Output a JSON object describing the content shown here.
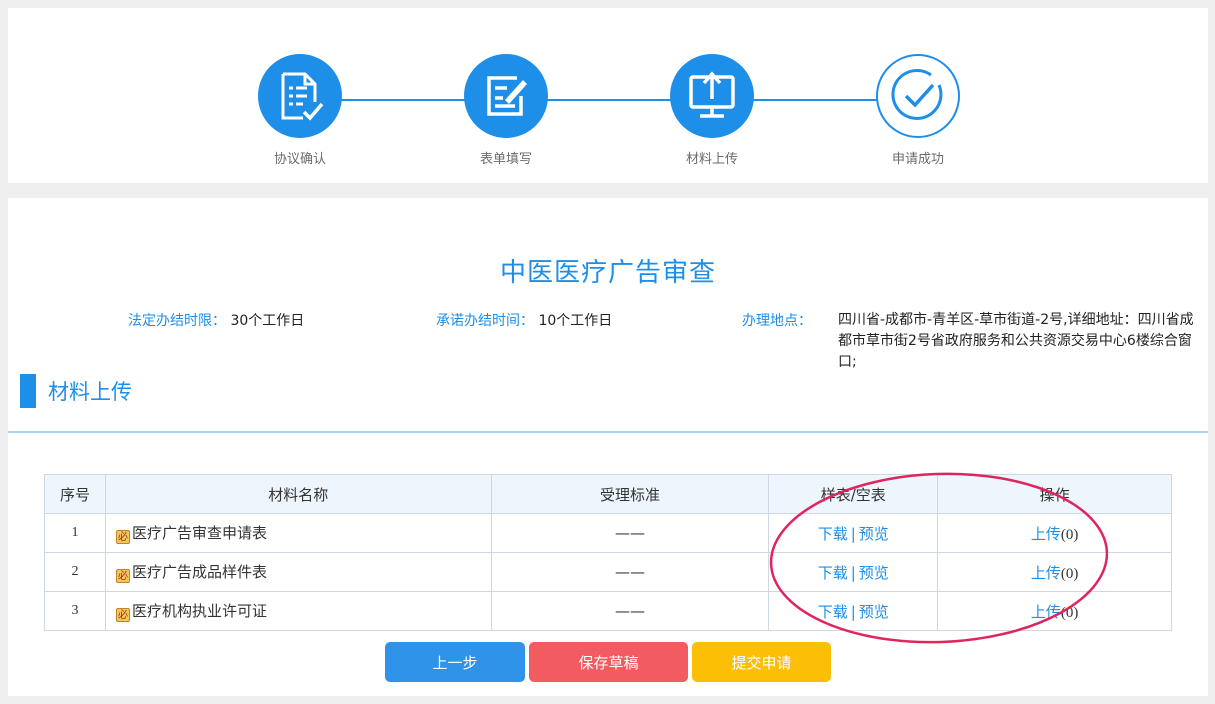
{
  "steps": [
    {
      "label": "协议确认",
      "icon": "document-check-icon"
    },
    {
      "label": "表单填写",
      "icon": "edit-form-icon"
    },
    {
      "label": "材料上传",
      "icon": "monitor-upload-icon"
    },
    {
      "label": "申请成功",
      "icon": "circle-check-icon"
    }
  ],
  "title": "中医医疗广告审查",
  "info": {
    "legal_label": "法定办结时限：",
    "legal_value": "30个工作日",
    "promise_label": "承诺办结时间：",
    "promise_value": "10个工作日",
    "address_label": "办理地点：",
    "address_value": "四川省-成都市-青羊区-草市街道-2号,详细地址：四川省成都市草市街2号省政府服务和公共资源交易中心6楼综合窗口;"
  },
  "section_title": "材料上传",
  "table": {
    "headers": [
      "序号",
      "材料名称",
      "受理标准",
      "样表/空表",
      "操作"
    ],
    "required_mark": "必",
    "rows": [
      {
        "no": "1",
        "name": "医疗广告审查申请表",
        "standard": "——",
        "download": "下载",
        "separator": "|",
        "preview": "预览",
        "upload": "上传",
        "count": "(0)"
      },
      {
        "no": "2",
        "name": "医疗广告成品样件表",
        "standard": "——",
        "download": "下载",
        "separator": "|",
        "preview": "预览",
        "upload": "上传",
        "count": "(0)"
      },
      {
        "no": "3",
        "name": "医疗机构执业许可证",
        "standard": "——",
        "download": "下载",
        "separator": "|",
        "preview": "预览",
        "upload": "上传",
        "count": "(0)"
      }
    ]
  },
  "buttons": {
    "prev": "上一步",
    "draft": "保存草稿",
    "submit": "提交申请"
  },
  "colors": {
    "accent": "#1e8fe8",
    "prev": "#2f93ea",
    "draft": "#f25b5f",
    "submit": "#fdbf05",
    "annotation": "#e0245e"
  }
}
